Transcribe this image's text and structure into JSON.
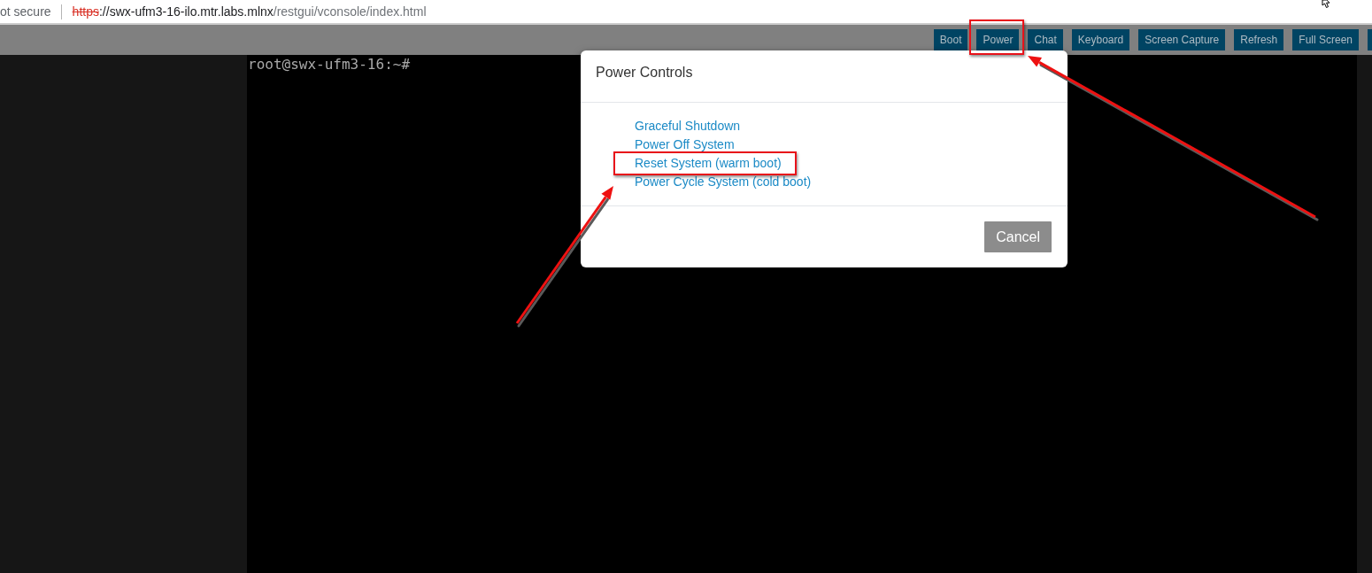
{
  "address_bar": {
    "security_label": "ot secure",
    "secure": false,
    "url": {
      "scheme": "https",
      "separator": "://",
      "host": "swx-ufm3-16-ilo.mtr.labs.mlnx",
      "path": "/restgui/vconsole/index.html"
    }
  },
  "toolbar": {
    "buttons": [
      {
        "label": "Boot",
        "highlighted": false
      },
      {
        "label": "Power",
        "highlighted": true
      },
      {
        "label": "Chat",
        "highlighted": false
      },
      {
        "label": "Keyboard",
        "highlighted": false
      },
      {
        "label": "Screen Capture",
        "highlighted": false
      },
      {
        "label": "Refresh",
        "highlighted": false
      },
      {
        "label": "Full Screen",
        "highlighted": false
      },
      {
        "highlighted": false
      }
    ]
  },
  "console": {
    "lines": [
      "root@swx-ufm3-16:~#"
    ]
  },
  "dialog": {
    "title": "Power Controls",
    "options": [
      {
        "label": "Graceful Shutdown",
        "highlighted": false
      },
      {
        "label": "Power Off System",
        "highlighted": false
      },
      {
        "label": "Reset System (warm boot)",
        "highlighted": true
      },
      {
        "label": "Power Cycle System (cold boot)",
        "highlighted": false
      }
    ],
    "buttons": [
      "Cancel"
    ]
  }
}
